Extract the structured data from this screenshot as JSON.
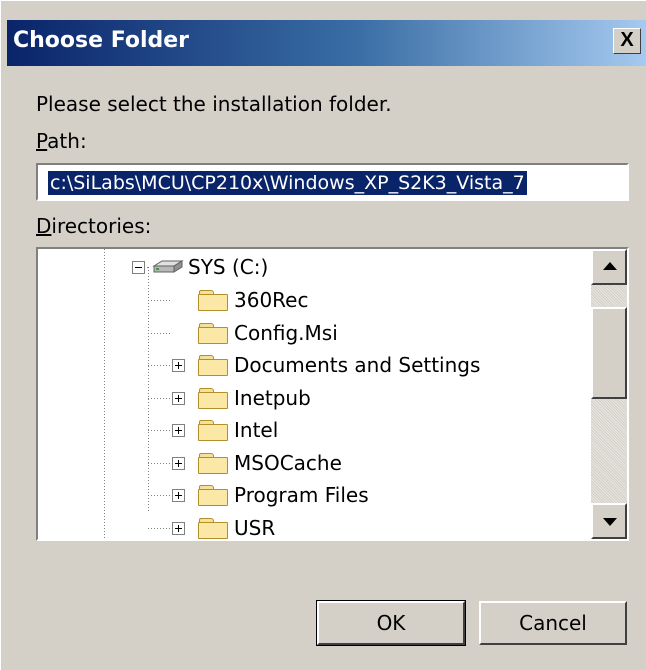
{
  "window": {
    "title": "Choose Folder",
    "close_label": "X"
  },
  "prompt": "Please select the installation folder.",
  "path": {
    "label_first": "P",
    "label_rest": "ath:",
    "value": "c:\\SiLabs\\MCU\\CP210x\\Windows_XP_S2K3_Vista_7"
  },
  "directories": {
    "label_first": "D",
    "label_rest": "irectories:",
    "drive": "SYS (C:)",
    "folders": [
      {
        "name": "360Rec",
        "expandable": false
      },
      {
        "name": "Config.Msi",
        "expandable": false
      },
      {
        "name": "Documents and Settings",
        "expandable": true
      },
      {
        "name": "Inetpub",
        "expandable": true
      },
      {
        "name": "Intel",
        "expandable": true
      },
      {
        "name": "MSOCache",
        "expandable": true
      },
      {
        "name": "Program Files",
        "expandable": true
      },
      {
        "name": "USR",
        "expandable": true
      }
    ]
  },
  "buttons": {
    "ok": "OK",
    "cancel": "Cancel"
  },
  "colors": {
    "face": "#d4d0c8",
    "title_start": "#0a246a",
    "title_end": "#a6caf0",
    "selection": "#0a246a"
  }
}
